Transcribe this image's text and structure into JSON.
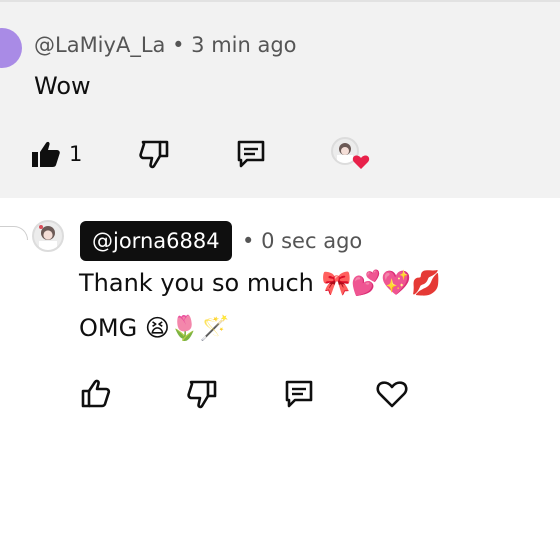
{
  "comment": {
    "handle": "@LaMiyA_La",
    "time": "3 min ago",
    "text": "Wow",
    "like_count": "1"
  },
  "reply": {
    "handle": "@jorna6884",
    "time": "0 sec ago",
    "line1": "Thank you so much 🎀💕💖💋",
    "line2": "OMG 😫🌷🪄"
  },
  "separator": "•",
  "icons": {
    "like": "thumbs-up-icon",
    "dislike": "thumbs-down-icon",
    "reply": "reply-comment-icon",
    "heart": "heart-icon",
    "creator_heart": "creator-heart-badge"
  },
  "colors": {
    "top_background": "#f2f2f2",
    "heart_red": "#e8214a",
    "chip_background": "#0f0f0f"
  }
}
